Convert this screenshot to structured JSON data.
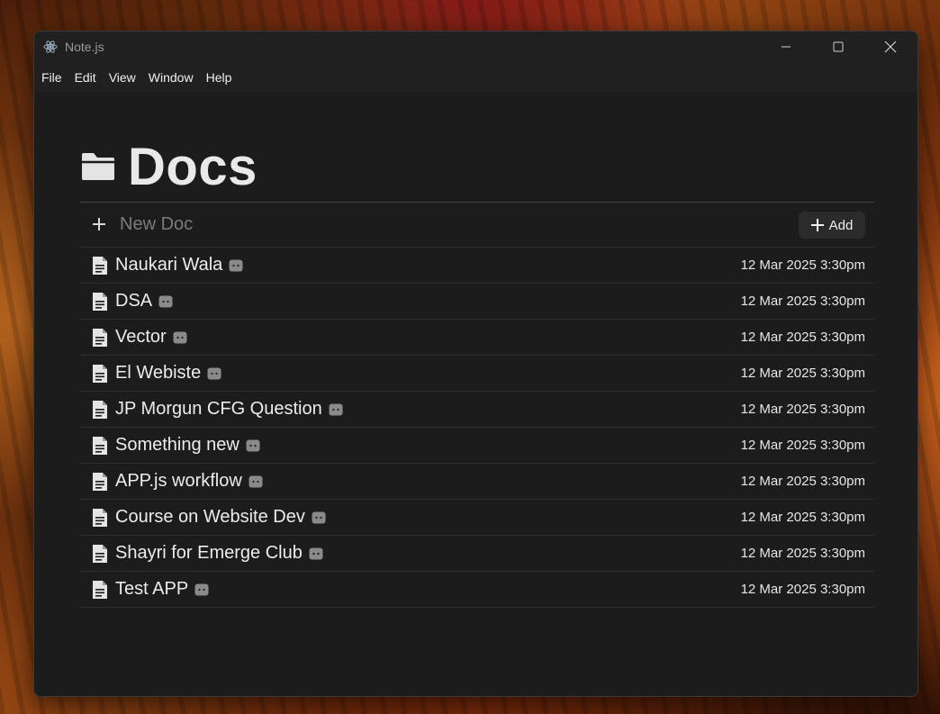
{
  "window": {
    "title": "Note.js"
  },
  "menu": [
    "File",
    "Edit",
    "View",
    "Window",
    "Help"
  ],
  "page": {
    "title": "Docs",
    "folder_icon": "folder-icon"
  },
  "new_doc": {
    "placeholder": "New Doc",
    "add_label": "Add"
  },
  "docs": [
    {
      "name": "Naukari Wala",
      "date": "12 Mar 2025 3:30pm"
    },
    {
      "name": "DSA",
      "date": "12 Mar 2025 3:30pm"
    },
    {
      "name": "Vector",
      "date": "12 Mar 2025 3:30pm"
    },
    {
      "name": "El Webiste",
      "date": "12 Mar 2025 3:30pm"
    },
    {
      "name": "JP Morgun CFG Question",
      "date": "12 Mar 2025 3:30pm"
    },
    {
      "name": "Something new",
      "date": "12 Mar 2025 3:30pm"
    },
    {
      "name": "APP.js workflow",
      "date": "12 Mar 2025 3:30pm"
    },
    {
      "name": "Course on Website Dev",
      "date": "12 Mar 2025 3:30pm"
    },
    {
      "name": "Shayri for Emerge Club",
      "date": "12 Mar 2025 3:30pm"
    },
    {
      "name": "Test APP",
      "date": "12 Mar 2025 3:30pm"
    }
  ],
  "colors": {
    "window_bg": "#1c1c1c",
    "titlebar_bg": "#202020",
    "text": "#e6e6e6",
    "muted": "#7b7b7b",
    "divider": "#2e2e2e"
  }
}
